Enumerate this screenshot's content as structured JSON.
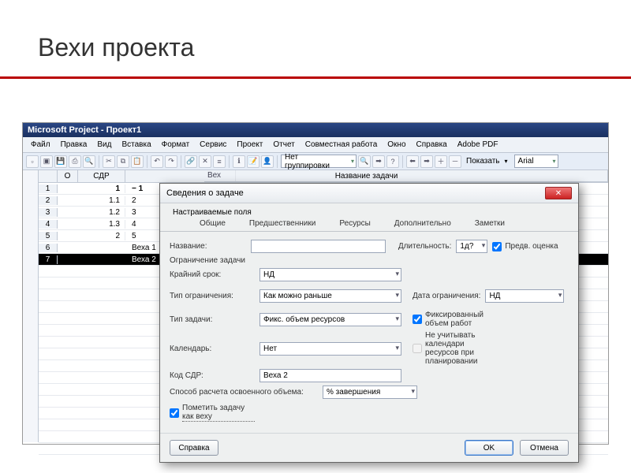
{
  "slide": {
    "title": "Вехи проекта"
  },
  "app": {
    "title": "Microsoft Project - Проект1",
    "menu": [
      "Файл",
      "Правка",
      "Вид",
      "Вставка",
      "Формат",
      "Сервис",
      "Проект",
      "Отчет",
      "Совместная работа",
      "Окно",
      "Справка",
      "Adobe PDF"
    ],
    "toolbar": {
      "group_combo": "Нет группировки",
      "show_label": "Показать",
      "font_combo": "Arial"
    }
  },
  "grid": {
    "cols": [
      "",
      "О",
      "СДР",
      "Название задачи"
    ],
    "timeline_label": "Вех",
    "rows": [
      {
        "n": "1",
        "wbs": "1",
        "name": "− 1",
        "bold": true
      },
      {
        "n": "2",
        "wbs": "1.1",
        "name": "2"
      },
      {
        "n": "3",
        "wbs": "1.2",
        "name": "3"
      },
      {
        "n": "4",
        "wbs": "1.3",
        "name": "4"
      },
      {
        "n": "5",
        "wbs": "2",
        "name": "5"
      },
      {
        "n": "6",
        "wbs": "",
        "name": "Веха 1"
      },
      {
        "n": "7",
        "wbs": "",
        "name": "Веха 2",
        "selected": true
      }
    ]
  },
  "dialog": {
    "title": "Сведения о задаче",
    "tabs_top": {
      "left": "Настраиваемые поля"
    },
    "tabs_bottom": [
      "Общие",
      "Предшественники",
      "Ресурсы",
      "Дополнительно",
      "Заметки"
    ],
    "active_tab": "Дополнительно",
    "fields": {
      "name_label": "Название:",
      "name_value": "",
      "duration_label": "Длительность:",
      "duration_value": "1д?",
      "prelim_label": "Предв. оценка",
      "constraint_section": "Ограничение задачи",
      "deadline_label": "Крайний срок:",
      "deadline_value": "НД",
      "constraint_type_label": "Тип ограничения:",
      "constraint_type_value": "Как можно раньше",
      "constraint_date_label": "Дата ограничения:",
      "constraint_date_value": "НД",
      "task_type_label": "Тип задачи:",
      "task_type_value": "Фикс. объем ресурсов",
      "fixed_work_label": "Фиксированный объем работ",
      "calendar_label": "Календарь:",
      "calendar_value": "Нет",
      "ignore_cal_label": "Не учитывать календари ресурсов при планировании",
      "wbs_code_label": "Код СДР:",
      "wbs_code_value": "Веха 2",
      "ev_method_label": "Способ расчета освоенного объема:",
      "ev_method_value": "% завершения",
      "milestone_label": "Пометить задачу как веху"
    },
    "buttons": {
      "help": "Справка",
      "ok": "OK",
      "cancel": "Отмена"
    }
  }
}
